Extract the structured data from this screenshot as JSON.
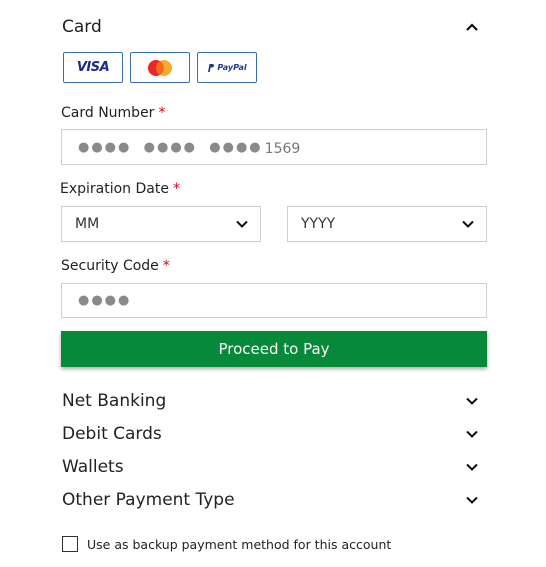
{
  "card_section": {
    "title": "Card",
    "toggle_icon": "chevron-up-icon",
    "card_brands": [
      {
        "name": "VISA",
        "icon": "visa-logo"
      },
      {
        "name": "MasterCard",
        "icon": "mastercard-logo"
      },
      {
        "name": "PayPal",
        "icon": "paypal-logo"
      }
    ],
    "card_number": {
      "label": "Card Number",
      "required_mark": "*",
      "masked_value": "●●●●  ●●●●  ●●●●",
      "last_digits": "1569"
    },
    "expiration": {
      "label": "Expiration Date",
      "required_mark": "*",
      "month_value": "MM",
      "year_value": "YYYY"
    },
    "security_code": {
      "label": "Security Code",
      "required_mark": "*",
      "masked_value": "●●●●"
    },
    "proceed_button": "Proceed to Pay"
  },
  "other_sections": [
    {
      "title": "Net Banking",
      "icon": "chevron-down-icon"
    },
    {
      "title": "Debit Cards",
      "icon": "chevron-down-icon"
    },
    {
      "title": "Wallets",
      "icon": "chevron-down-icon"
    },
    {
      "title": "Other Payment Type",
      "icon": "chevron-down-icon"
    }
  ],
  "backup": {
    "label": "Use as backup payment method for this account",
    "checked": false
  },
  "colors": {
    "primary_green": "#068a3a",
    "required_red": "#d0021b",
    "card_border_blue": "#3a6fb3"
  }
}
